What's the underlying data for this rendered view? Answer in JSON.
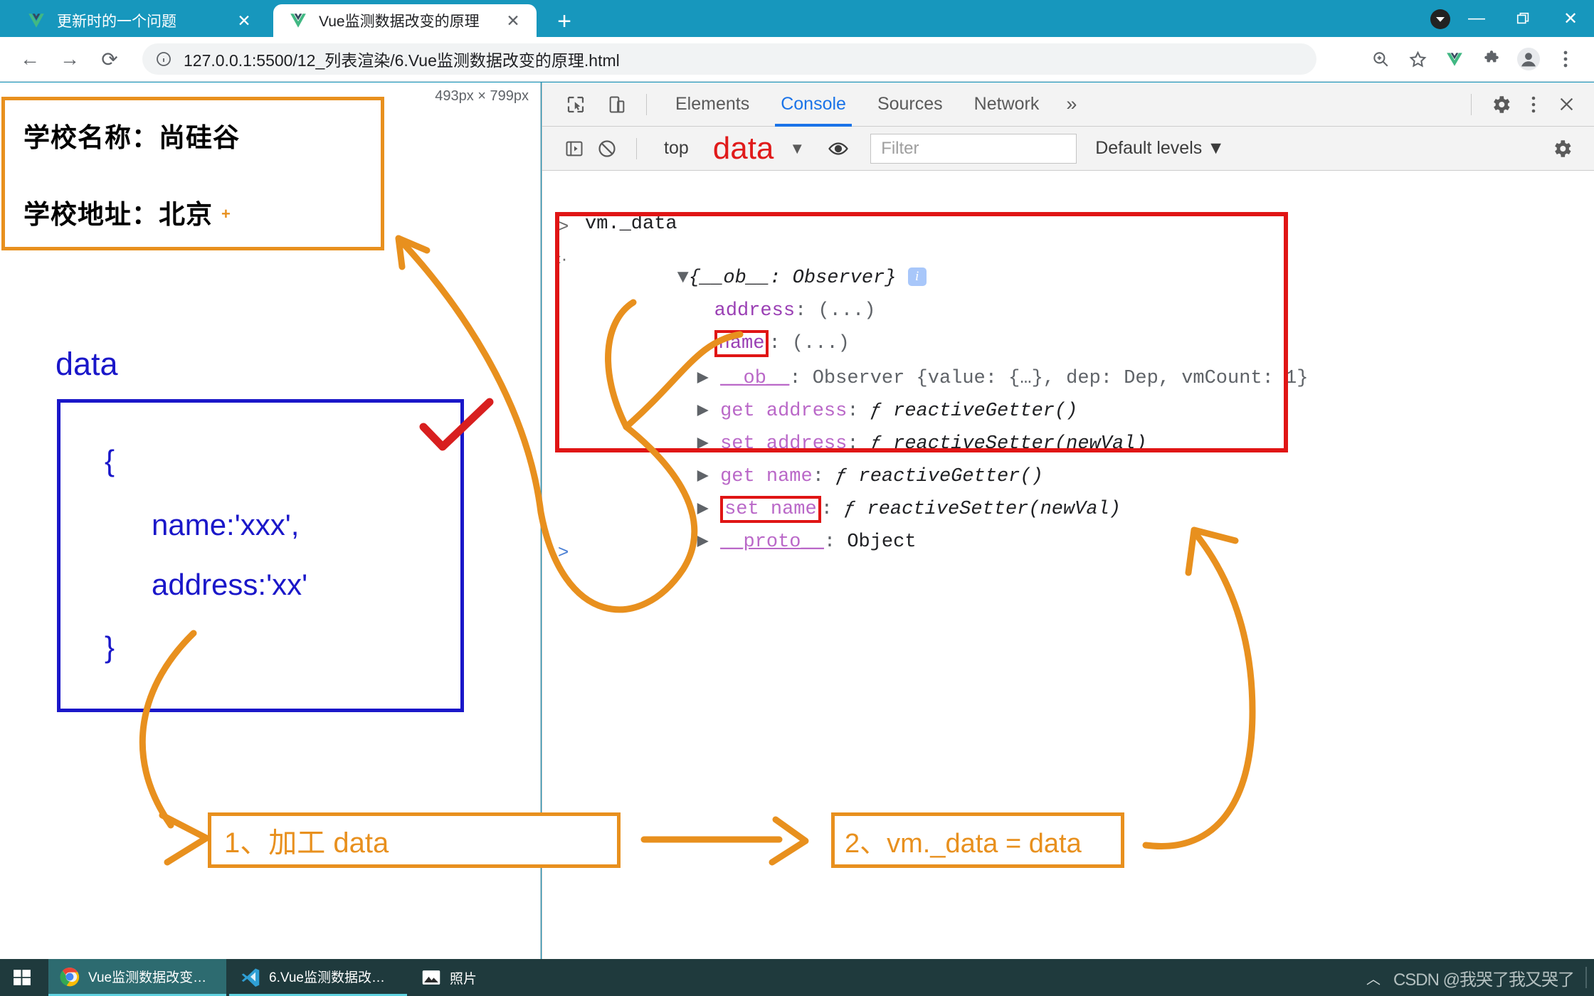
{
  "browser": {
    "tabs": [
      {
        "title": "更新时的一个问题",
        "active": false,
        "close_label": "✕",
        "favicon": "vue-logo-icon"
      },
      {
        "title": "Vue监测数据改变的原理",
        "active": true,
        "close_label": "✕",
        "favicon": "vue-logo-icon"
      }
    ],
    "new_tab_label": "+",
    "window_controls": {
      "minimize": "—",
      "maximize": "❐",
      "close": "✕"
    },
    "toolbar": {
      "back": "←",
      "forward": "→",
      "reload": "⟳",
      "url": "127.0.0.1:5500/12_列表渲染/6.Vue监测数据改变的原理.html",
      "info_icon": "page-info-icon",
      "right_icons": [
        "zoom-icon",
        "bookmark-star-icon",
        "vue-devtools-icon",
        "extensions-puzzle-icon",
        "profile-avatar-icon",
        "chrome-menu-icon"
      ]
    }
  },
  "page": {
    "size_badge": "493px × 799px",
    "school": {
      "name_line": "学校名称：尚硅谷",
      "address_line": "学校地址：北京",
      "plus_marker": "+"
    },
    "data_label": "data",
    "code_box": {
      "open_brace": "{",
      "line_name": "name:'xxx',",
      "line_address": "address:'xx'",
      "close_brace": "}"
    },
    "annotations": {
      "box1": "1、加工 data",
      "box2": "2、vm._data = data"
    }
  },
  "devtools": {
    "tools": {
      "inspect_icon": "inspect-element-icon",
      "device_icon": "device-toolbar-icon"
    },
    "tabs": [
      {
        "label": "Elements",
        "selected": false
      },
      {
        "label": "Console",
        "selected": true
      },
      {
        "label": "Sources",
        "selected": false
      },
      {
        "label": "Network",
        "selected": false
      }
    ],
    "more_tabs": "»",
    "settings_icon": "settings-gear-icon",
    "menu_icon": "devtools-menu-icon",
    "close_icon": "devtools-close-icon",
    "console_toolbar": {
      "execute_icon": "execute-sidebar-icon",
      "clear_icon": "clear-console-icon",
      "context": "top",
      "context_annotation": "data",
      "context_caret": "▼",
      "eye_icon": "live-expression-eye-icon",
      "filter_placeholder": "Filter",
      "levels": "Default levels",
      "levels_caret": "▼",
      "settings_icon": "console-settings-gear-icon"
    },
    "console": {
      "prompt_glyph": ">",
      "result_glyph": "‹·",
      "input_expression": "vm._data",
      "result_header": "{__ob__: Observer}",
      "result_badge": "i",
      "rows": [
        {
          "indent": 1,
          "arrow": "",
          "key": "address",
          "sep": ": ",
          "value": "(...)"
        },
        {
          "indent": 1,
          "arrow": "",
          "key": "name",
          "sep": ": ",
          "value": "(...)",
          "highlighted": true
        },
        {
          "indent": 1,
          "arrow": "▶",
          "key": "__ob__",
          "sep": ": ",
          "value": "Observer {value: {…}, dep: Dep, vmCount: 1}"
        },
        {
          "indent": 1,
          "arrow": "▶",
          "key": "get address",
          "sep": ": ",
          "value": "ƒ reactiveGetter()"
        },
        {
          "indent": 1,
          "arrow": "▶",
          "key": "set address",
          "sep": ": ",
          "value": "ƒ reactiveSetter(newVal)"
        },
        {
          "indent": 1,
          "arrow": "▶",
          "key": "get name",
          "sep": ": ",
          "value": "ƒ reactiveGetter()"
        },
        {
          "indent": 1,
          "arrow": "▶",
          "key": "set name",
          "sep": ": ",
          "value": "ƒ reactiveSetter(newVal)",
          "highlighted": true
        },
        {
          "indent": 1,
          "arrow": "▶",
          "key": "__proto__",
          "sep": ": ",
          "value": "Object"
        }
      ],
      "next_prompt_glyph": ">"
    }
  },
  "taskbar": {
    "start_label": "start-windows-icon",
    "items": [
      {
        "label": "Vue监测数据改变的...",
        "icon": "chrome-icon",
        "active": true
      },
      {
        "label": "6.Vue监测数据改变...",
        "icon": "vscode-icon",
        "active": false
      },
      {
        "label": "照片",
        "icon": "photos-icon",
        "active": false
      }
    ],
    "tray_caret": "︿",
    "watermark": "CSDN @我哭了我又哭了"
  },
  "colors": {
    "chrome_blue": "#1797bd",
    "annotation_orange": "#e8901e",
    "annotation_red": "#e01515",
    "code_blue": "#1a17c9",
    "devtools_accent": "#1a73e8",
    "checkmark_red": "#d81f1f"
  }
}
